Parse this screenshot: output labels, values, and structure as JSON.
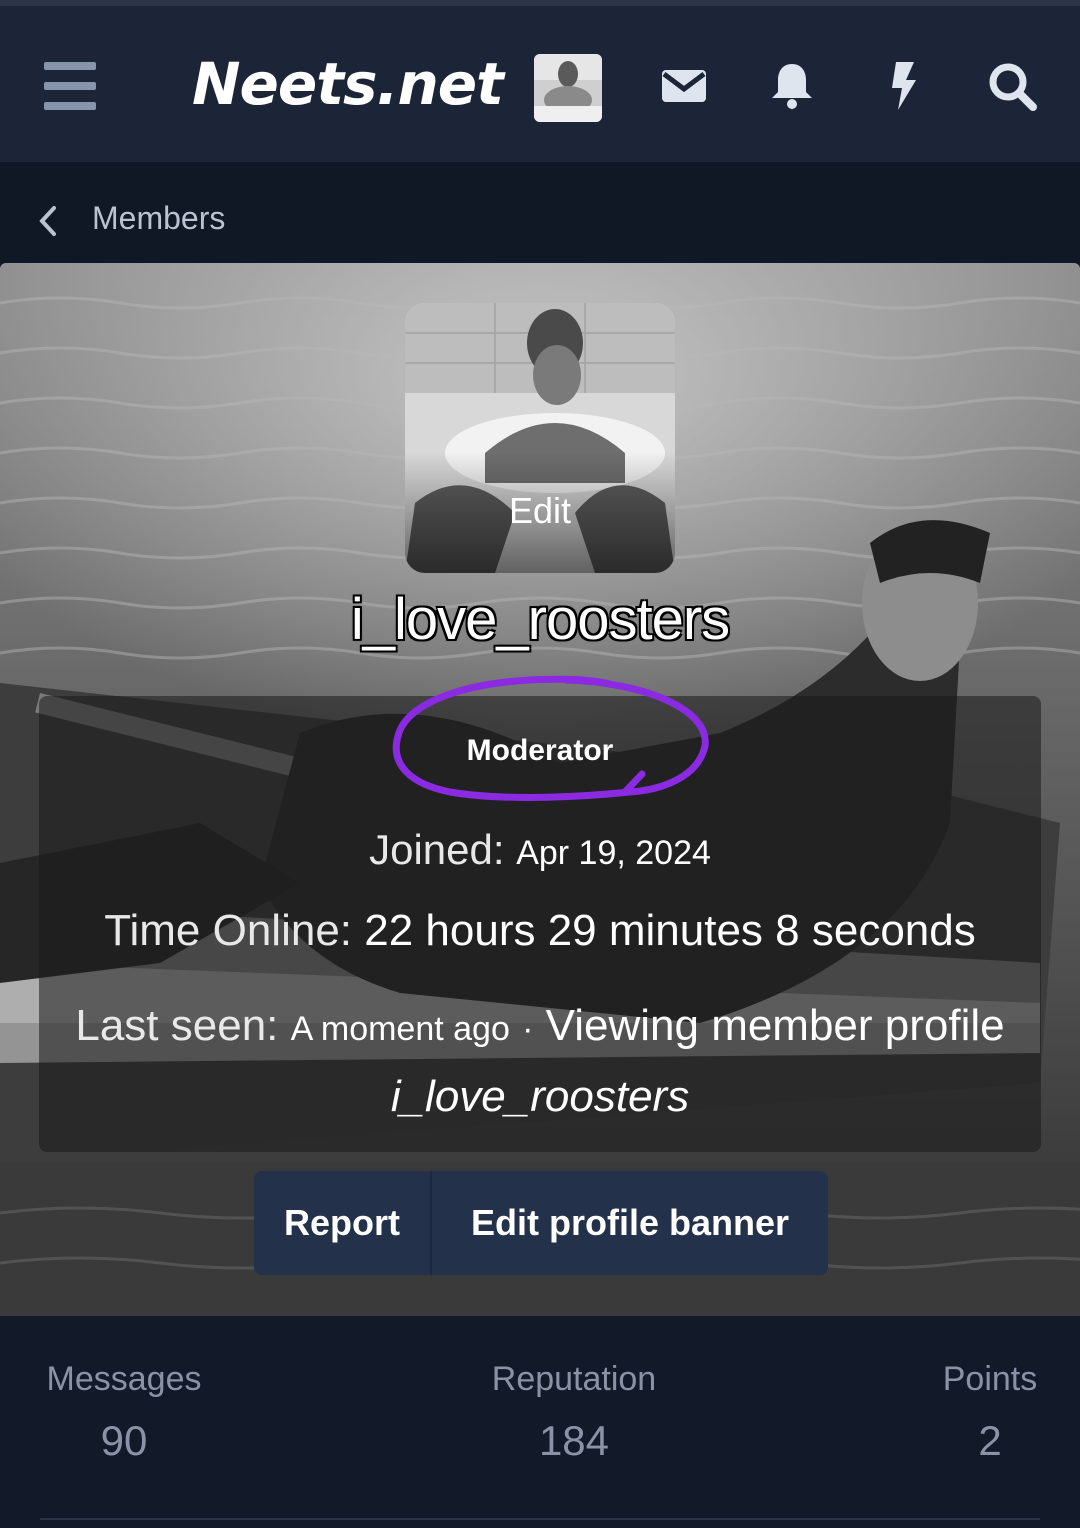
{
  "header": {
    "brand": "Neets.net",
    "icons": [
      "menu-icon",
      "user-avatar",
      "envelope-icon",
      "bell-icon",
      "bolt-icon",
      "search-icon"
    ]
  },
  "breadcrumb": {
    "label": "Members"
  },
  "profile": {
    "avatar_edit_label": "Edit",
    "username": "i_love_roosters",
    "role": "Moderator",
    "joined_label": "Joined:",
    "joined_value": "Apr 19, 2024",
    "time_online_label": "Time Online:",
    "time_online_value": "22 hours 29 minutes 8 seconds",
    "last_seen_label": "Last seen:",
    "last_seen_value": "A moment ago",
    "activity_separator": "·",
    "activity_text": "Viewing member profile",
    "activity_target": "i_love_roosters"
  },
  "actions": {
    "report": "Report",
    "edit_banner": "Edit profile banner"
  },
  "stats": {
    "messages_label": "Messages",
    "messages_value": "90",
    "reputation_label": "Reputation",
    "reputation_value": "184",
    "points_label": "Points",
    "points_value": "2"
  },
  "colors": {
    "header_bg": "#1b2537",
    "breadcrumb_bg": "#101725",
    "button_bg": "#24314a",
    "stats_bg": "#121a2a",
    "annotation_circle": "#8a2be2"
  }
}
